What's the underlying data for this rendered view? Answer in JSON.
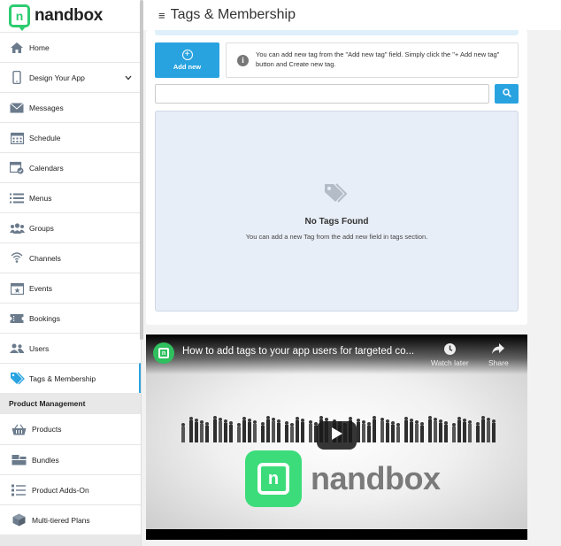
{
  "app": {
    "logo_text": "nandbox",
    "logo_glyph": "n"
  },
  "header": {
    "title": "Tags & Membership",
    "menu_glyph": "≡"
  },
  "sidebar": {
    "items": [
      {
        "label": "Home",
        "icon": "home-icon"
      },
      {
        "label": "Design Your App",
        "icon": "phone-icon",
        "has_chevron": true
      },
      {
        "label": "Messages",
        "icon": "envelope-icon"
      },
      {
        "label": "Schedule",
        "icon": "calendar-grid-icon"
      },
      {
        "label": "Calendars",
        "icon": "calendar-check-icon"
      },
      {
        "label": "Menus",
        "icon": "list-icon"
      },
      {
        "label": "Groups",
        "icon": "users-group-icon"
      },
      {
        "label": "Channels",
        "icon": "broadcast-icon"
      },
      {
        "label": "Events",
        "icon": "calendar-star-icon"
      },
      {
        "label": "Bookings",
        "icon": "ticket-icon"
      },
      {
        "label": "Users",
        "icon": "users-icon"
      },
      {
        "label": "Tags & Membership",
        "icon": "tags-icon",
        "active": true
      }
    ],
    "section_product": "Product Management",
    "product_items": [
      {
        "label": "Products",
        "icon": "basket-icon"
      },
      {
        "label": "Bundles",
        "icon": "bundle-icon"
      },
      {
        "label": "Product Adds-On",
        "icon": "addon-list-icon"
      },
      {
        "label": "Multi-tiered Plans",
        "icon": "box-icon"
      }
    ]
  },
  "main": {
    "add_button_label": "Add new",
    "info_text": "You can add new tag from the \"Add new tag\" field. Simply click the \"+ Add new tag\" button and Create new tag.",
    "search": {
      "value": "",
      "placeholder": ""
    },
    "empty_title": "No Tags Found",
    "empty_subtitle": "You can add a new Tag from the add new field in tags section."
  },
  "video": {
    "title": "How to add tags to your app users for targeted co...",
    "watch_later": "Watch later",
    "share": "Share",
    "brand_text": "nandbox",
    "brand_glyph": "n"
  },
  "colors": {
    "accent": "#29a3e0",
    "brand_green": "#2ecc71",
    "empty_bg": "#e8eef7"
  }
}
